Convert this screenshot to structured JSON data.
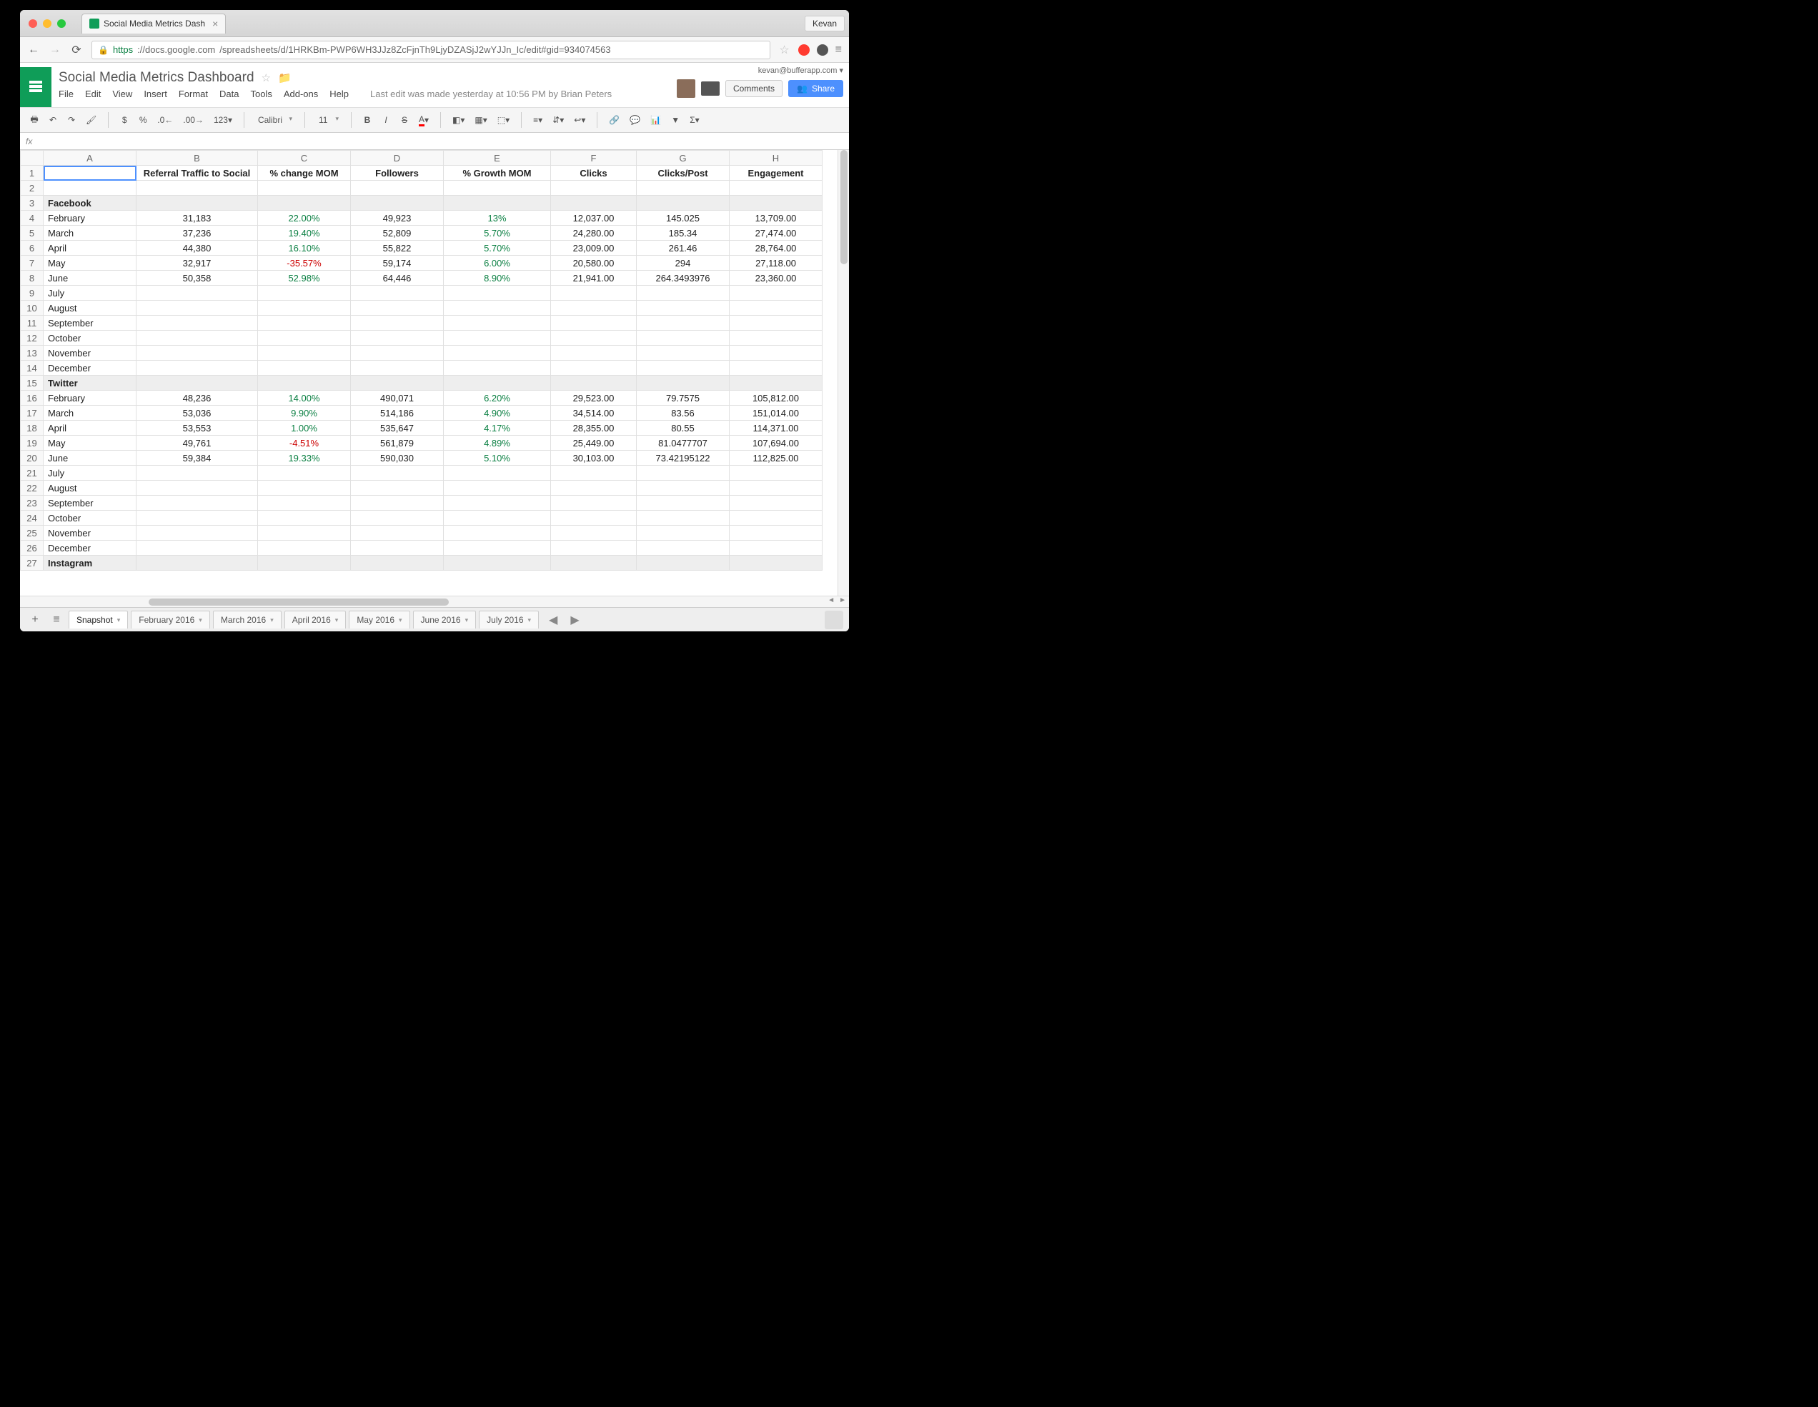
{
  "browser": {
    "profile": "Kevan",
    "tab_title": "Social Media Metrics Dash",
    "url_https": "https",
    "url_host": "://docs.google.com",
    "url_path": "/spreadsheets/d/1HRKBm-PWP6WH3JJz8ZcFjnTh9LjyDZASjJ2wYJJn_Ic/edit#gid=934074563"
  },
  "docs": {
    "title": "Social Media Metrics Dashboard",
    "menus": [
      "File",
      "Edit",
      "View",
      "Insert",
      "Format",
      "Data",
      "Tools",
      "Add-ons",
      "Help"
    ],
    "last_edit": "Last edit was made yesterday at 10:56 PM by Brian Peters",
    "account": "kevan@bufferapp.com",
    "comments_btn": "Comments",
    "share_btn": "Share"
  },
  "toolbar": {
    "font": "Calibri",
    "size": "11"
  },
  "columns": [
    "A",
    "B",
    "C",
    "D",
    "E",
    "F",
    "G",
    "H"
  ],
  "headers": {
    "A": "",
    "B": "Referral Traffic to Social",
    "C": "% change MOM",
    "D": "Followers",
    "E": "% Growth MOM",
    "F": "Clicks",
    "G": "Clicks/Post",
    "H": "Engagement"
  },
  "sections": [
    {
      "row": 3,
      "label": "Facebook"
    },
    {
      "row": 15,
      "label": "Twitter"
    },
    {
      "row": 27,
      "label": "Instagram"
    }
  ],
  "rows": [
    {
      "r": 4,
      "A": "February",
      "B": "31,183",
      "C": "22.00%",
      "Cc": "pos",
      "D": "49,923",
      "E": "13%",
      "Ec": "pos",
      "F": "12,037.00",
      "G": "145.025",
      "H": "13,709.00"
    },
    {
      "r": 5,
      "A": "March",
      "B": "37,236",
      "C": "19.40%",
      "Cc": "pos",
      "D": "52,809",
      "E": "5.70%",
      "Ec": "pos",
      "F": "24,280.00",
      "G": "185.34",
      "H": "27,474.00"
    },
    {
      "r": 6,
      "A": "April",
      "B": "44,380",
      "C": "16.10%",
      "Cc": "pos",
      "D": "55,822",
      "E": "5.70%",
      "Ec": "pos",
      "F": "23,009.00",
      "G": "261.46",
      "H": "28,764.00"
    },
    {
      "r": 7,
      "A": "May",
      "B": "32,917",
      "C": "-35.57%",
      "Cc": "neg",
      "D": "59,174",
      "E": "6.00%",
      "Ec": "pos",
      "F": "20,580.00",
      "G": "294",
      "H": "27,118.00"
    },
    {
      "r": 8,
      "A": "June",
      "B": "50,358",
      "C": "52.98%",
      "Cc": "pos",
      "D": "64,446",
      "E": "8.90%",
      "Ec": "pos",
      "F": "21,941.00",
      "G": "264.3493976",
      "H": "23,360.00"
    },
    {
      "r": 9,
      "A": "July"
    },
    {
      "r": 10,
      "A": "August"
    },
    {
      "r": 11,
      "A": "September"
    },
    {
      "r": 12,
      "A": "October"
    },
    {
      "r": 13,
      "A": "November"
    },
    {
      "r": 14,
      "A": "December"
    },
    {
      "r": 16,
      "A": "February",
      "B": "48,236",
      "C": "14.00%",
      "Cc": "pos",
      "D": "490,071",
      "E": "6.20%",
      "Ec": "pos",
      "F": "29,523.00",
      "G": "79.7575",
      "H": "105,812.00"
    },
    {
      "r": 17,
      "A": "March",
      "B": "53,036",
      "C": "9.90%",
      "Cc": "pos",
      "D": "514,186",
      "E": "4.90%",
      "Ec": "pos",
      "F": "34,514.00",
      "G": "83.56",
      "H": "151,014.00"
    },
    {
      "r": 18,
      "A": "April",
      "B": "53,553",
      "C": "1.00%",
      "Cc": "pos",
      "D": "535,647",
      "E": "4.17%",
      "Ec": "pos",
      "F": "28,355.00",
      "G": "80.55",
      "H": "114,371.00"
    },
    {
      "r": 19,
      "A": "May",
      "B": "49,761",
      "C": "-4.51%",
      "Cc": "neg",
      "D": "561,879",
      "E": "4.89%",
      "Ec": "pos",
      "F": "25,449.00",
      "G": "81.0477707",
      "H": "107,694.00"
    },
    {
      "r": 20,
      "A": "June",
      "B": "59,384",
      "C": "19.33%",
      "Cc": "pos",
      "D": "590,030",
      "E": "5.10%",
      "Ec": "pos",
      "F": "30,103.00",
      "G": "73.42195122",
      "H": "112,825.00"
    },
    {
      "r": 21,
      "A": "July"
    },
    {
      "r": 22,
      "A": "August"
    },
    {
      "r": 23,
      "A": "September"
    },
    {
      "r": 24,
      "A": "October"
    },
    {
      "r": 25,
      "A": "November"
    },
    {
      "r": 26,
      "A": "December"
    }
  ],
  "sheet_tabs": [
    "Snapshot",
    "February 2016",
    "March 2016",
    "April 2016",
    "May 2016",
    "June 2016",
    "July 2016"
  ],
  "active_tab": "Snapshot"
}
